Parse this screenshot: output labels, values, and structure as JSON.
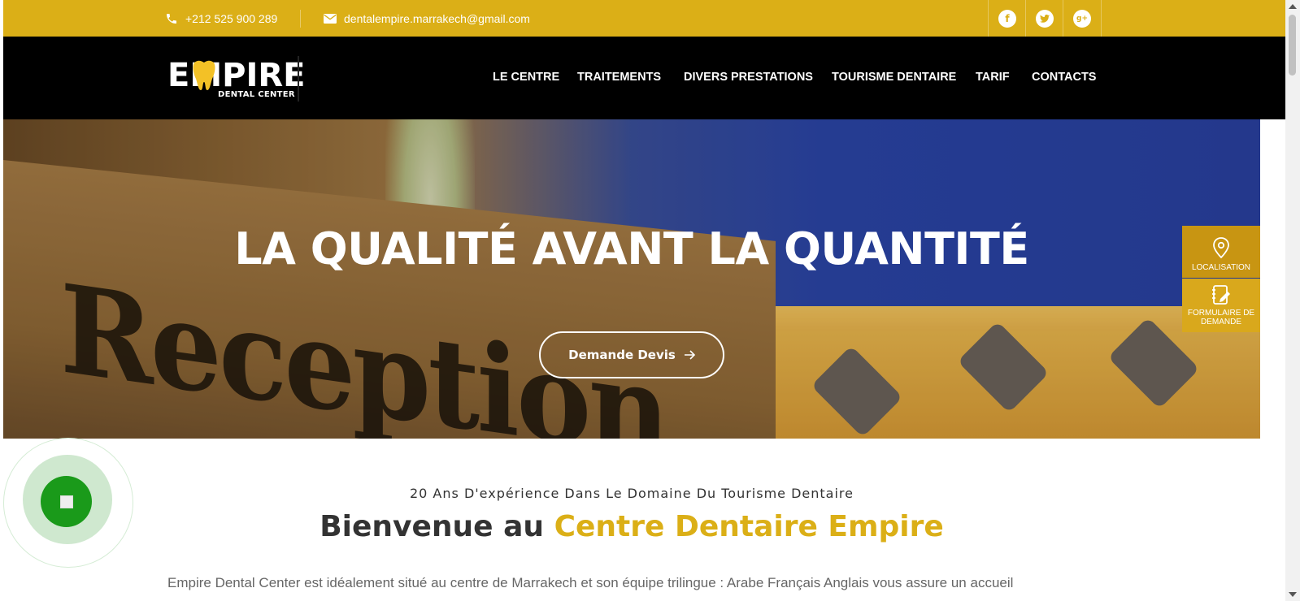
{
  "topbar": {
    "phone": "+212 525 900 289",
    "email": "dentalempire.marrakech@gmail.com",
    "social": [
      {
        "icon": "facebook-icon",
        "glyph": "f"
      },
      {
        "icon": "twitter-icon",
        "glyph": "t"
      },
      {
        "icon": "google-plus-icon",
        "glyph": "g+"
      }
    ]
  },
  "logo": {
    "word": "EMPIRE",
    "sub": "DENTAL CENTER"
  },
  "nav": {
    "items": [
      "LE CENTRE",
      "TRAITEMENTS",
      "DIVERS PRESTATIONS",
      "TOURISME DENTAIRE",
      "TARIF",
      "CONTACTS"
    ]
  },
  "hero": {
    "title": "LA QUALITÉ AVANT LA QUANTITÉ",
    "button": "Demande Devis",
    "background_text": "Reception"
  },
  "side_widget": {
    "localisation": "LOCALISATION",
    "formulaire": "FORMULAIRE DE DEMANDE"
  },
  "content": {
    "subtitle": "20 Ans D'expérience Dans Le Domaine Du Tourisme Dentaire",
    "welcome_prefix": "Bienvenue au ",
    "welcome_accent": "Centre Dentaire Empire",
    "intro": "Empire Dental Center est idéalement situé au centre de Marrakech et son équipe trilingue : Arabe Français Anglais vous assure un accueil"
  },
  "colors": {
    "brand": "#dbaf17",
    "nav_bg": "#000000",
    "whatsapp": "#1a9a1a"
  }
}
